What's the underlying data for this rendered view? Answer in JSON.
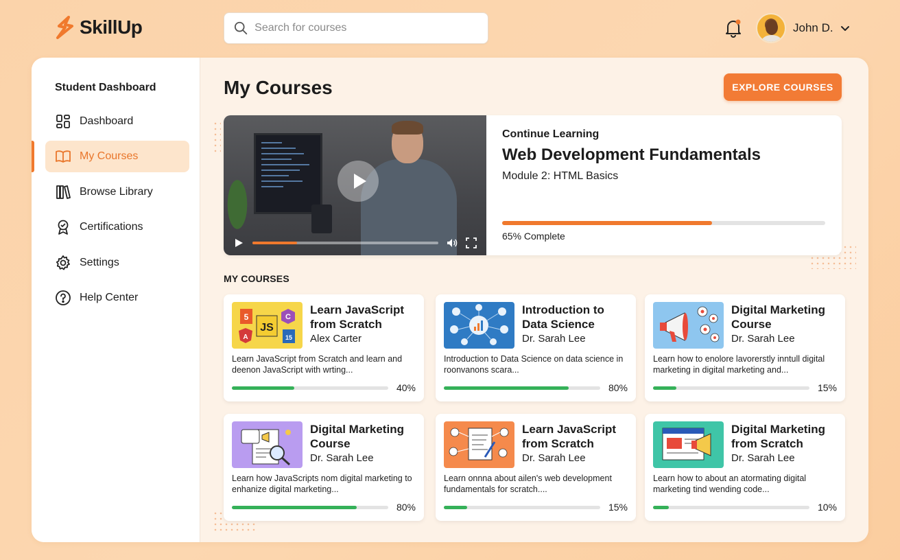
{
  "app": {
    "name": "SkillUp",
    "brand_color": "#f0792d"
  },
  "search": {
    "placeholder": "Search for courses"
  },
  "header": {
    "user_name": "John D.",
    "notification_icon": "bell-icon",
    "has_notification": true
  },
  "sidebar": {
    "title": "Student Dashboard",
    "items": [
      {
        "label": "Dashboard",
        "icon": "grid-icon",
        "active": false
      },
      {
        "label": "My Courses",
        "icon": "book-icon",
        "active": true
      },
      {
        "label": "Browse Library",
        "icon": "library-icon",
        "active": false
      },
      {
        "label": "Certifications",
        "icon": "certificate-icon",
        "active": false
      },
      {
        "label": "Settings",
        "icon": "gear-icon",
        "active": false
      },
      {
        "label": "Help Center",
        "icon": "help-icon",
        "active": false
      }
    ]
  },
  "main": {
    "title": "My Courses",
    "explore_button": "EXPLORE COURSES",
    "continue": {
      "eyebrow": "Continue Learning",
      "course_title": "Web Development Fundamentals",
      "module": "Module 2: HTML Basics",
      "progress": 0.65,
      "progress_label": "65% Complete",
      "video_progress": 0.24
    },
    "section_label": "MY COURSES",
    "courses": [
      {
        "title": "Learn JavaScript from Scratch",
        "author": "Alex Carter",
        "description": "Learn JavaScript from Scratch and learn and deenon JavaScript with wrting...",
        "progress": 0.4,
        "progress_label": "40%",
        "thumb": "js-icons",
        "thumb_color": "#f6d64a"
      },
      {
        "title": "Introduction to Data Science",
        "author": "Dr. Sarah Lee",
        "description": "Introduction to Data Science on data science in roonvanons scara...",
        "progress": 0.8,
        "progress_label": "80%",
        "thumb": "data-network",
        "thumb_color": "#2f7bc4"
      },
      {
        "title": "Digital Marketing Course",
        "author": "Dr. Sarah Lee",
        "description": "Learn how to enolore lavorerstly inntull digital marketing in digital marketing and...",
        "progress": 0.15,
        "progress_label": "15%",
        "thumb": "megaphone",
        "thumb_color": "#8ec6ef"
      },
      {
        "title": "Digital Marketing Course",
        "author": "Dr. Sarah Lee",
        "description": "Learn how JavaScripts nom digital marketing to enhanize digital marketing...",
        "progress": 0.8,
        "progress_label": "80%",
        "thumb": "document-search",
        "thumb_color": "#b99cf0"
      },
      {
        "title": "Learn JavaScript from Scratch",
        "author": "Dr. Sarah Lee",
        "description": "Learn onnna about ailen's web development fundamentals for scratch....",
        "progress": 0.15,
        "progress_label": "15%",
        "thumb": "document-network",
        "thumb_color": "#f58a4c"
      },
      {
        "title": "Digital Marketing from Scratch",
        "author": "Dr. Sarah Lee",
        "description": "Learn how to about an atormating digital marketing tind wending code...",
        "progress": 0.1,
        "progress_label": "10%",
        "thumb": "browser-megaphone",
        "thumb_color": "#3fc5a7"
      }
    ]
  },
  "colors": {
    "progress_green": "#35b159",
    "progress_orange": "#f0792d",
    "active_bg": "#fde5cc"
  }
}
